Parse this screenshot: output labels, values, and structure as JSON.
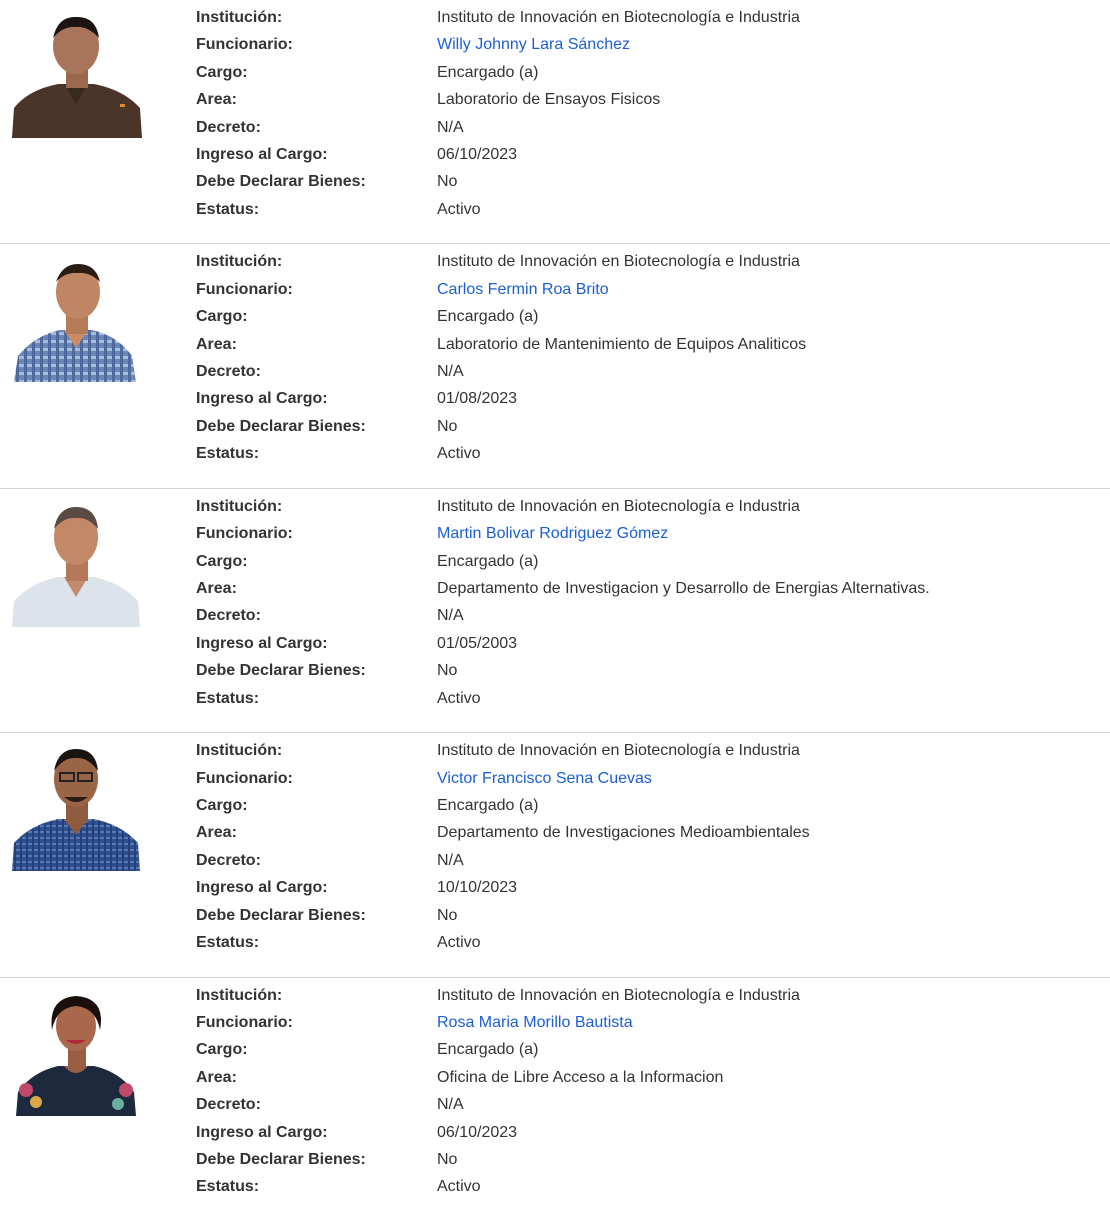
{
  "labels": {
    "institucion": "Institución:",
    "funcionario": "Funcionario:",
    "cargo": "Cargo:",
    "area": "Area:",
    "decreto": "Decreto:",
    "ingreso": "Ingreso al Cargo:",
    "declarar": "Debe Declarar Bienes:",
    "estatus": "Estatus:"
  },
  "colors": {
    "link": "#1a5fd6",
    "divider": "#d4d4d4",
    "text": "#333333"
  },
  "records": [
    {
      "photo": "portrait-man-brown-polo",
      "institucion": "Instituto de Innovación en Biotecnología e Industria",
      "funcionario": "Willy Johnny Lara Sánchez",
      "cargo": "Encargado (a)",
      "area": "Laboratorio de Ensayos Fisicos",
      "decreto": "N/A",
      "ingreso": "06/10/2023",
      "declarar": "No",
      "estatus": "Activo"
    },
    {
      "photo": "portrait-man-blue-plaid-shirt",
      "institucion": "Instituto de Innovación en Biotecnología e Industria",
      "funcionario": "Carlos Fermin Roa Brito",
      "cargo": "Encargado (a)",
      "area": "Laboratorio de Mantenimiento de Equipos Analiticos",
      "decreto": "N/A",
      "ingreso": "01/08/2023",
      "declarar": "No",
      "estatus": "Activo"
    },
    {
      "photo": "portrait-older-man-light-shirt",
      "institucion": "Instituto de Innovación en Biotecnología e Industria",
      "funcionario": "Martin Bolivar Rodriguez Gómez",
      "cargo": "Encargado (a)",
      "area": "Departamento de Investigacion y Desarrollo de Energias Alternativas.",
      "decreto": "N/A",
      "ingreso": "01/05/2003",
      "declarar": "No",
      "estatus": "Activo"
    },
    {
      "photo": "portrait-man-glasses-blue-shirt",
      "institucion": "Instituto de Innovación en Biotecnología e Industria",
      "funcionario": "Victor Francisco Sena Cuevas",
      "cargo": "Encargado (a)",
      "area": "Departamento de Investigaciones Medioambientales",
      "decreto": "N/A",
      "ingreso": "10/10/2023",
      "declarar": "No",
      "estatus": "Activo"
    },
    {
      "photo": "portrait-woman-dark-top",
      "institucion": "Instituto de Innovación en Biotecnología e Industria",
      "funcionario": "Rosa Maria Morillo Bautista",
      "cargo": "Encargado (a)",
      "area": "Oficina de Libre Acceso a la Informacion",
      "decreto": "N/A",
      "ingreso": "06/10/2023",
      "declarar": "No",
      "estatus": "Activo"
    }
  ]
}
